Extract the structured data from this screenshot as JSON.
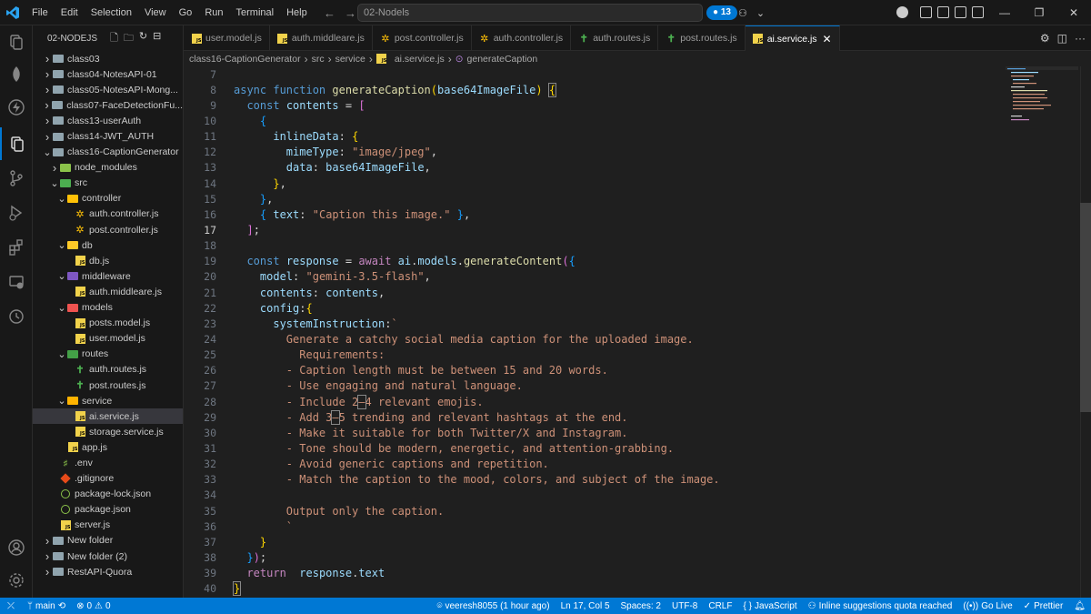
{
  "titlebar": {
    "menu": [
      "File",
      "Edit",
      "Selection",
      "View",
      "Go",
      "Run",
      "Terminal",
      "Help"
    ],
    "search_text": "02-Nodels",
    "notifications": "13"
  },
  "explorer": {
    "title": "02-NODEJS",
    "items": [
      {
        "label": "class03",
        "depth": 0,
        "type": "folder",
        "open": false
      },
      {
        "label": "class04-NotesAPI-01",
        "depth": 0,
        "type": "folder",
        "open": false
      },
      {
        "label": "class05-NotesAPI-Mong...",
        "depth": 0,
        "type": "folder",
        "open": false
      },
      {
        "label": "class07-FaceDetectionFu...",
        "depth": 0,
        "type": "folder",
        "open": false
      },
      {
        "label": "class13-userAuth",
        "depth": 0,
        "type": "folder",
        "open": false
      },
      {
        "label": "class14-JWT_AUTH",
        "depth": 0,
        "type": "folder",
        "open": false
      },
      {
        "label": "class16-CaptionGenerator",
        "depth": 0,
        "type": "folder",
        "open": true
      },
      {
        "label": "node_modules",
        "depth": 1,
        "type": "folder-node",
        "open": false
      },
      {
        "label": "src",
        "depth": 1,
        "type": "folder-src",
        "open": true
      },
      {
        "label": "controller",
        "depth": 2,
        "type": "folder-ctrl",
        "open": true
      },
      {
        "label": "auth.controller.js",
        "depth": 3,
        "type": "gear"
      },
      {
        "label": "post.controller.js",
        "depth": 3,
        "type": "gear"
      },
      {
        "label": "db",
        "depth": 2,
        "type": "folder-db",
        "open": true
      },
      {
        "label": "db.js",
        "depth": 3,
        "type": "js"
      },
      {
        "label": "middleware",
        "depth": 2,
        "type": "folder-mw",
        "open": true
      },
      {
        "label": "auth.middleare.js",
        "depth": 3,
        "type": "js"
      },
      {
        "label": "models",
        "depth": 2,
        "type": "folder-models",
        "open": true
      },
      {
        "label": "posts.model.js",
        "depth": 3,
        "type": "js"
      },
      {
        "label": "user.model.js",
        "depth": 3,
        "type": "js"
      },
      {
        "label": "routes",
        "depth": 2,
        "type": "folder-routes",
        "open": true
      },
      {
        "label": "auth.routes.js",
        "depth": 3,
        "type": "route"
      },
      {
        "label": "post.routes.js",
        "depth": 3,
        "type": "route"
      },
      {
        "label": "service",
        "depth": 2,
        "type": "folder-service",
        "open": true
      },
      {
        "label": "ai.service.js",
        "depth": 3,
        "type": "js",
        "selected": true
      },
      {
        "label": "storage.service.js",
        "depth": 3,
        "type": "js"
      },
      {
        "label": "app.js",
        "depth": 2,
        "type": "js"
      },
      {
        "label": ".env",
        "depth": 1,
        "type": "env"
      },
      {
        "label": ".gitignore",
        "depth": 1,
        "type": "git"
      },
      {
        "label": "package-lock.json",
        "depth": 1,
        "type": "pkg"
      },
      {
        "label": "package.json",
        "depth": 1,
        "type": "pkg"
      },
      {
        "label": "server.js",
        "depth": 1,
        "type": "js"
      },
      {
        "label": "New folder",
        "depth": 0,
        "type": "folder",
        "open": false
      },
      {
        "label": "New folder (2)",
        "depth": 0,
        "type": "folder",
        "open": false
      },
      {
        "label": "RestAPI-Quora",
        "depth": 0,
        "type": "folder",
        "open": false
      }
    ]
  },
  "tabs": [
    {
      "label": "user.model.js",
      "icon": "js"
    },
    {
      "label": "auth.middleare.js",
      "icon": "js"
    },
    {
      "label": "post.controller.js",
      "icon": "gear"
    },
    {
      "label": "auth.controller.js",
      "icon": "gear"
    },
    {
      "label": "auth.routes.js",
      "icon": "route"
    },
    {
      "label": "post.routes.js",
      "icon": "route"
    },
    {
      "label": "ai.service.js",
      "icon": "js",
      "active": true
    }
  ],
  "breadcrumb": [
    "class16-CaptionGenerator",
    "src",
    "service",
    "ai.service.js",
    "generateCaption"
  ],
  "code_lines": [
    {
      "n": "7",
      "html": ""
    },
    {
      "n": "8",
      "html": "<span class='kw'>async</span> <span class='kw'>function</span> <span class='fn'>generateCaption</span><span class='br1'>(</span><span class='var'>base64ImageFile</span><span class='br1'>)</span> <span class='br1' style='outline:1px solid #888'>{</span>"
    },
    {
      "n": "9",
      "html": "  <span class='kw'>const</span> <span class='var'>contents</span> <span class='pun'>=</span> <span class='br2'>[</span>"
    },
    {
      "n": "10",
      "html": "    <span class='br3'>{</span>"
    },
    {
      "n": "11",
      "html": "      <span class='var'>inlineData</span><span class='pun'>:</span> <span class='br1'>{</span>"
    },
    {
      "n": "12",
      "html": "        <span class='var'>mimeType</span><span class='pun'>:</span> <span class='str'>\"image/jpeg\"</span><span class='pun'>,</span>"
    },
    {
      "n": "13",
      "html": "        <span class='var'>data</span><span class='pun'>:</span> <span class='var'>base64ImageFile</span><span class='pun'>,</span>"
    },
    {
      "n": "14",
      "html": "      <span class='br1'>}</span><span class='pun'>,</span>"
    },
    {
      "n": "15",
      "html": "    <span class='br3'>}</span><span class='pun'>,</span>"
    },
    {
      "n": "16",
      "html": "    <span class='br3'>{</span> <span class='var'>text</span><span class='pun'>:</span> <span class='str'>\"Caption this image.\"</span> <span class='br3'>}</span><span class='pun'>,</span>"
    },
    {
      "n": "17",
      "html": "  <span class='br2'>]</span><span class='pun'>;</span>",
      "current": true
    },
    {
      "n": "18",
      "html": ""
    },
    {
      "n": "19",
      "html": "  <span class='kw'>const</span> <span class='var'>response</span> <span class='pun'>=</span> <span class='ctl'>await</span> <span class='var'>ai</span><span class='pun'>.</span><span class='var'>models</span><span class='pun'>.</span><span class='fn'>generateContent</span><span class='br2'>(</span><span class='br3'>{</span>"
    },
    {
      "n": "20",
      "html": "    <span class='var'>model</span><span class='pun'>:</span> <span class='str'>\"gemini-3.5-flash\"</span><span class='pun'>,</span>"
    },
    {
      "n": "21",
      "html": "    <span class='var'>contents</span><span class='pun'>:</span> <span class='var'>contents</span><span class='pun'>,</span>"
    },
    {
      "n": "22",
      "html": "    <span class='var'>config</span><span class='pun'>:</span><span class='br1'>{</span>"
    },
    {
      "n": "23",
      "html": "      <span class='var'>systemInstruction</span><span class='pun'>:</span><span class='str'>`</span>"
    },
    {
      "n": "24",
      "html": "        <span class='str'>Generate a catchy social media caption for the uploaded image.</span>"
    },
    {
      "n": "25",
      "html": "          <span class='str'>Requirements:</span>"
    },
    {
      "n": "26",
      "html": "        <span class='str'>- Caption length must be between 15 and 20 words.</span>"
    },
    {
      "n": "27",
      "html": "        <span class='str'>- Use engaging and natural language.</span>"
    },
    {
      "n": "28",
      "html": "        <span class='str'>- Include 2</span><span class='str' style='outline:1px solid #888'>–</span><span class='str'>4 relevant emojis.</span>"
    },
    {
      "n": "29",
      "html": "        <span class='str'>- Add 3</span><span class='str' style='outline:1px solid #888'>–</span><span class='str'>5 trending and relevant hashtags at the end.</span>"
    },
    {
      "n": "30",
      "html": "        <span class='str'>- Make it suitable for both Twitter/X and Instagram.</span>"
    },
    {
      "n": "31",
      "html": "        <span class='str'>- Tone should be modern, energetic, and attention-grabbing.</span>"
    },
    {
      "n": "32",
      "html": "        <span class='str'>- Avoid generic captions and repetition.</span>"
    },
    {
      "n": "33",
      "html": "        <span class='str'>- Match the caption to the mood, colors, and subject of the image.</span>"
    },
    {
      "n": "34",
      "html": ""
    },
    {
      "n": "35",
      "html": "        <span class='str'>Output only the caption.</span>"
    },
    {
      "n": "36",
      "html": "        <span class='str'>`</span>"
    },
    {
      "n": "37",
      "html": "    <span class='br1'>}</span>"
    },
    {
      "n": "38",
      "html": "  <span class='br3'>}</span><span class='br2'>)</span><span class='pun'>;</span>"
    },
    {
      "n": "39",
      "html": "  <span class='ctl'>return</span>  <span class='var'>response</span><span class='pun'>.</span><span class='var'>text</span>"
    },
    {
      "n": "40",
      "html": "<span class='br1' style='outline:1px solid #888'>}</span>"
    }
  ],
  "status": {
    "branch": "main",
    "errors": "0",
    "warnings": "0",
    "blame": "veeresh8055 (1 hour ago)",
    "position": "Ln 17, Col 5",
    "spaces": "Spaces: 2",
    "encoding": "UTF-8",
    "eol": "CRLF",
    "language": "JavaScript",
    "inline": "Inline suggestions quota reached",
    "golive": "Go Live",
    "prettier": "Prettier"
  },
  "colors": {
    "accent": "#0078d4",
    "js": "#f1d24b",
    "string": "#ce9178",
    "keyword": "#569cd6"
  }
}
